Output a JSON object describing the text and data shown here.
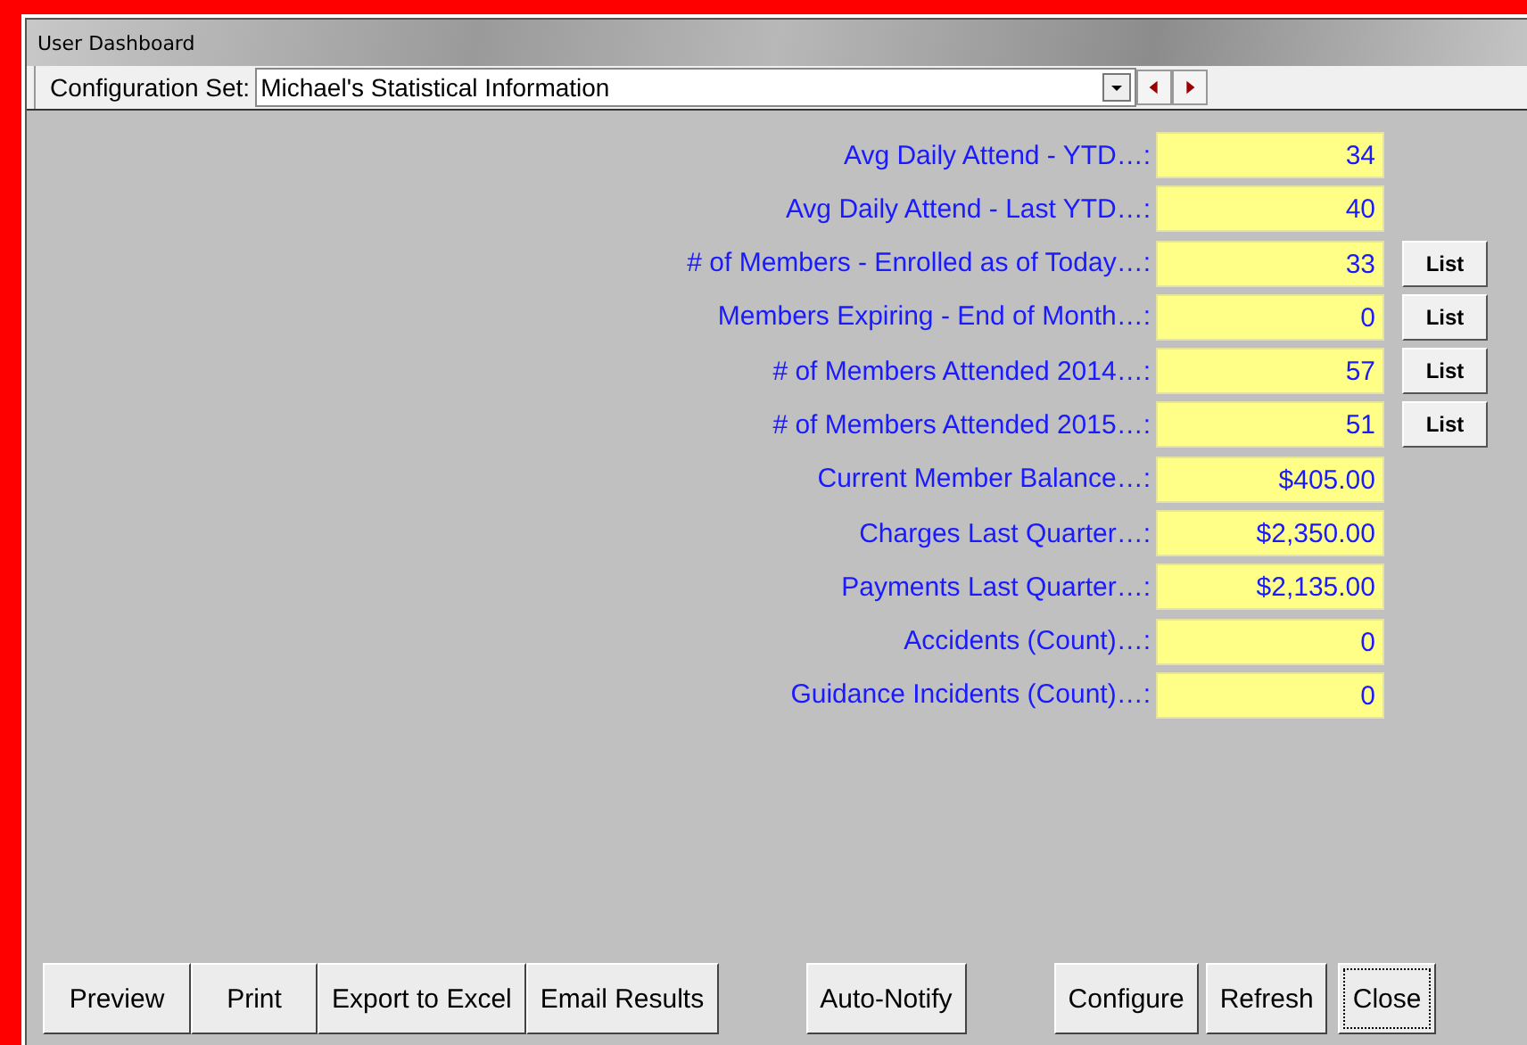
{
  "window": {
    "title": "User Dashboard"
  },
  "config_set": {
    "label": "Configuration Set:",
    "value": "Michael's Statistical Information"
  },
  "metrics": [
    {
      "label": "Avg Daily Attend - YTD…:",
      "value": "34"
    },
    {
      "label": "Avg Daily Attend - Last YTD…:",
      "value": "40"
    },
    {
      "label": "# of Members - Enrolled as of Today…:",
      "value": "33",
      "button": "List"
    },
    {
      "label": "Members Expiring - End of Month…:",
      "value": "0",
      "button": "List"
    },
    {
      "label": "# of Members Attended 2014…:",
      "value": "57",
      "button": "List"
    },
    {
      "label": "# of Members Attended 2015…:",
      "value": "51",
      "button": "List"
    },
    {
      "label": "Current Member Balance…:",
      "value": "$405.00"
    },
    {
      "label": "Charges Last Quarter…:",
      "value": "$2,350.00"
    },
    {
      "label": "Payments Last Quarter…:",
      "value": "$2,135.00"
    },
    {
      "label": "Accidents (Count)…:",
      "value": "0"
    },
    {
      "label": "Guidance Incidents (Count)…:",
      "value": "0"
    }
  ],
  "button_groups": [
    [
      {
        "label": "Preview",
        "focused": false
      },
      {
        "label": "Print",
        "focused": false
      },
      {
        "label": "Export to Excel",
        "focused": false
      },
      {
        "label": "Email Results",
        "focused": false
      }
    ],
    [
      {
        "label": "Auto-Notify",
        "focused": false
      }
    ],
    [
      {
        "label": "Configure",
        "focused": false
      },
      {
        "label": "Refresh",
        "focused": false
      },
      {
        "label": "Close",
        "focused": true
      }
    ]
  ]
}
